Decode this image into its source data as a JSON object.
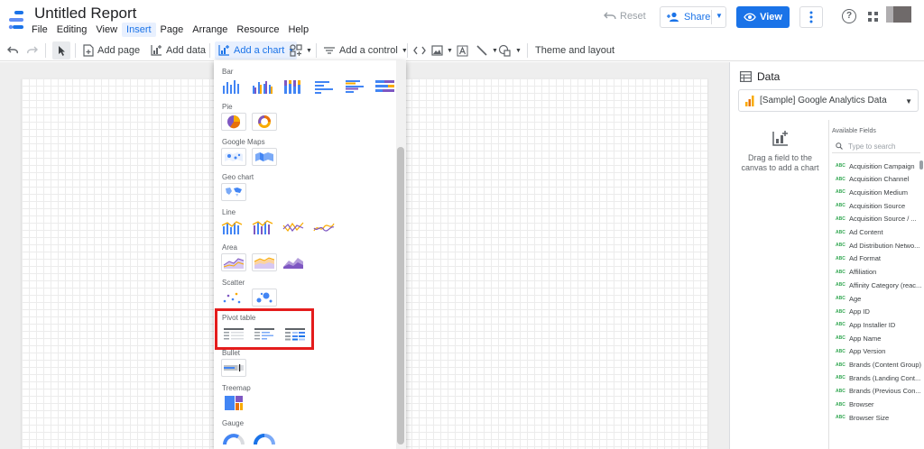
{
  "header": {
    "title": "Untitled Report",
    "menu": [
      "File",
      "Editing",
      "View",
      "Insert",
      "Page",
      "Arrange",
      "Resource",
      "Help"
    ],
    "active_menu": "Insert",
    "reset_label": "Reset",
    "share_label": "Share",
    "view_label": "View",
    "help_glyph": "?"
  },
  "toolbar": {
    "add_page": "Add page",
    "add_data": "Add data",
    "add_chart": "Add a chart",
    "add_control": "Add a control",
    "theme_layout": "Theme and layout"
  },
  "chart_menu": {
    "sections": [
      "Bar",
      "Pie",
      "Google Maps",
      "Geo chart",
      "Line",
      "Area",
      "Scatter",
      "Pivot table",
      "Bullet",
      "Treemap",
      "Gauge"
    ]
  },
  "data_panel": {
    "title": "Data",
    "source": "[Sample] Google Analytics Data",
    "drag_hint_1": "Drag a field to the",
    "drag_hint_2": "canvas to add a chart",
    "available_label": "Available Fields",
    "search_placeholder": "Type to search",
    "field_type": "ABC",
    "fields": [
      "Acquisition Campaign",
      "Acquisition Channel",
      "Acquisition Medium",
      "Acquisition Source",
      "Acquisition Source / ...",
      "Ad Content",
      "Ad Distribution Netwo...",
      "Ad Format",
      "Affiliation",
      "Affinity Category (reac...",
      "Age",
      "App ID",
      "App Installer ID",
      "App Name",
      "App Version",
      "Brands (Content Group)",
      "Brands (Landing Cont...",
      "Brands (Previous Con...",
      "Browser",
      "Browser Size"
    ]
  },
  "colors": {
    "accent": "#1a73e8",
    "highlight": "#e41c1c",
    "chart_blue": "#4285f4",
    "chart_purple": "#7e57c2",
    "chart_orange": "#f9ab00"
  }
}
